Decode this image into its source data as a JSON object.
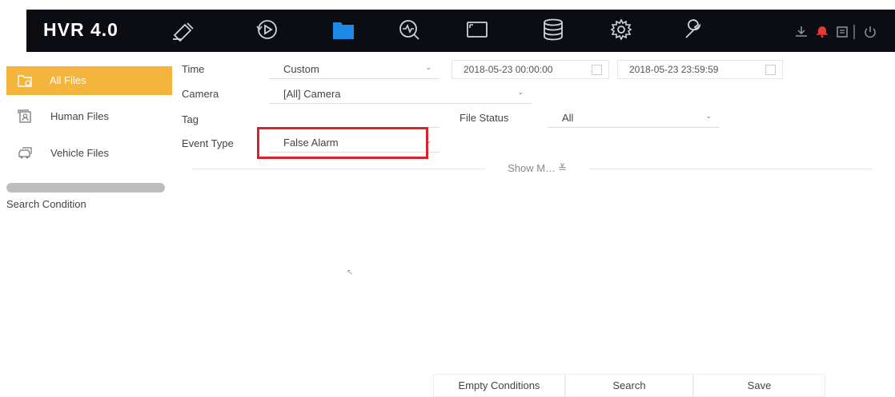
{
  "header": {
    "brand": "HVR 4.0",
    "nav": [
      {
        "name": "live-view-icon"
      },
      {
        "name": "playback-icon"
      },
      {
        "name": "file-management-icon",
        "active": true
      },
      {
        "name": "smart-analysis-icon"
      },
      {
        "name": "configuration-screen-icon"
      },
      {
        "name": "storage-icon"
      },
      {
        "name": "settings-icon"
      },
      {
        "name": "maintenance-icon"
      }
    ],
    "right_icons": [
      "download-icon",
      "alarm-bell-icon",
      "notification-icon",
      "power-icon"
    ],
    "accent": "#1e88e5",
    "alarm_color": "#e53935"
  },
  "sidebar": {
    "items": [
      {
        "label": "All Files",
        "icon": "all-files-icon",
        "active": true
      },
      {
        "label": "Human Files",
        "icon": "human-files-icon"
      },
      {
        "label": "Vehicle Files",
        "icon": "vehicle-files-icon"
      }
    ],
    "active_color": "#f5b43c",
    "search_condition_label": "Search Condition"
  },
  "form": {
    "time_label": "Time",
    "time_value": "Custom",
    "start_date": "2018-05-23 00:00:00",
    "end_date": "2018-05-23 23:59:59",
    "camera_label": "Camera",
    "camera_value": "[All] Camera",
    "tag_label": "Tag",
    "tag_value": "",
    "file_status_label": "File Status",
    "file_status_value": "All",
    "event_type_label": "Event Type",
    "event_type_value": "False Alarm",
    "show_more": "Show M…"
  },
  "buttons": {
    "empty": "Empty Conditions",
    "search": "Search",
    "save": "Save"
  }
}
